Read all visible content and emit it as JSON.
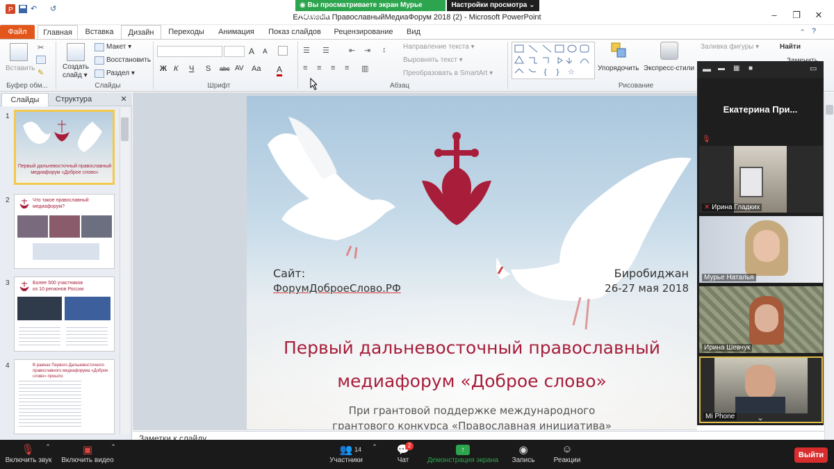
{
  "window": {
    "title": "EAOMedia ПравославныйМедиаФорум 2018 (2)  -  Microsoft PowerPoint",
    "controls": [
      "–",
      "❐",
      "✕"
    ]
  },
  "zoom_banner": {
    "sharing_text": "Вы просматриваете экран Мурье Натальи",
    "view_options": "Настройки просмотра ⌄"
  },
  "ribbon": {
    "tabs": [
      "Файл",
      "Главная",
      "Вставка",
      "Дизайн",
      "Переходы",
      "Анимация",
      "Показ слайдов",
      "Рецензирование",
      "Вид"
    ],
    "groups": {
      "clipboard": {
        "label": "Буфер обм...",
        "paste": "Вставить"
      },
      "slides": {
        "label": "Слайды",
        "new_slide": "Создать слайд ▾",
        "layout": "Макет ▾",
        "reset": "Восстановить",
        "section": "Раздел ▾"
      },
      "font": {
        "label": "Шрифт",
        "bold": "Ж",
        "italic": "К",
        "underline": "Ч",
        "strike": "S",
        "shadow": "abc",
        "spacing": "AV",
        "case": "Aa",
        "color": "A",
        "grow": "A",
        "shrink": "A"
      },
      "paragraph": {
        "label": "Абзац",
        "text_direction": "Направление текста ▾",
        "align_text": "Выровнять текст ▾",
        "smartart": "Преобразовать в SmartArt ▾"
      },
      "drawing": {
        "label": "Рисование",
        "arrange": "Упорядочить",
        "quick_styles": "Экспресс-стили",
        "fill": "Заливка фигуры ▾"
      },
      "editing": {
        "find": "Найти",
        "replace": "Заменить"
      }
    }
  },
  "left_pane": {
    "tabs": {
      "slides": "Слайды",
      "outline": "Структура",
      "close": "✕"
    },
    "thumbnails": [
      {
        "num": "1",
        "line1": "Первый дальневосточный православный",
        "line2": "медиафорум «Доброе слово»"
      },
      {
        "num": "2",
        "line1": "Что такое православный",
        "line2": "медиафорум?"
      },
      {
        "num": "3",
        "line1": "Более 500 участников",
        "line2": "из 10 регионов России"
      },
      {
        "num": "4",
        "line1": "В рамках Первого Дальневосточного",
        "line2": "православного медиафорума «Доброе слово» прошло:"
      }
    ]
  },
  "slide": {
    "site_label": "Сайт:",
    "site_url": "ФорумДоброеСлово.РФ",
    "city": "Биробиджан",
    "date": "26-27 мая 2018",
    "title_line1": "Первый дальневосточный православный",
    "title_line2": "медиафорум «Доброе слово»",
    "subtitle_line1": "При грантовой поддержке международного",
    "subtitle_line2": "грантового конкурса «Православная инициатива»"
  },
  "notes": {
    "placeholder": "Заметки к слайду"
  },
  "zoom_panel": {
    "active_speaker": "Екатерина  При...",
    "participants": [
      {
        "name": "Ирина Гладких"
      },
      {
        "name": "Мурье Наталья"
      },
      {
        "name": "Ирина Шевчук"
      },
      {
        "name": "Mi Phone"
      }
    ]
  },
  "zoom_toolbar": {
    "unmute": "Включить звук",
    "start_video": "Включить видео",
    "participants": "Участники",
    "participants_count": "14",
    "chat": "Чат",
    "chat_badge": "2",
    "share": "Демонстрация экрана",
    "record": "Запись",
    "reactions": "Реакции",
    "leave": "Выйти"
  },
  "colors": {
    "accent_red": "#a71d3a",
    "zoom_green": "#2da44e",
    "file_tab": "#e2561b"
  }
}
